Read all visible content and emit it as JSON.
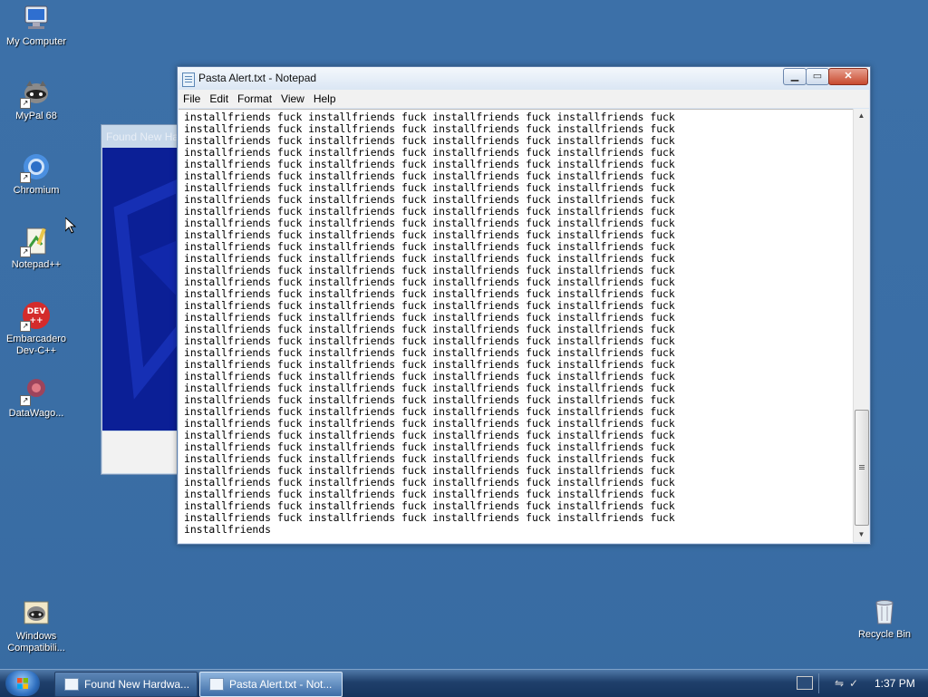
{
  "desktop": {
    "icons": [
      {
        "label": "My Computer",
        "icon": "computer-icon"
      },
      {
        "label": "MyPal 68",
        "icon": "raccoon-browser-icon"
      },
      {
        "label": "Chromium",
        "icon": "chromium-icon"
      },
      {
        "label": "Notepad++",
        "icon": "notepadpp-icon"
      },
      {
        "label": "Embarcadero Dev-C++",
        "icon": "devcpp-icon"
      },
      {
        "label": "DataWago...",
        "icon": "datawagon-icon"
      },
      {
        "label": "Windows Compatibili...",
        "icon": "raccoon-compat-icon"
      },
      {
        "label": "Recycle Bin",
        "icon": "recycle-bin-icon"
      }
    ]
  },
  "background_window": {
    "title": "Found New Ha..."
  },
  "notepad": {
    "title": "Pasta Alert.txt - Notepad",
    "menu": [
      "File",
      "Edit",
      "Format",
      "View",
      "Help"
    ],
    "text_line": "installfriends fuck installfriends fuck installfriends fuck installfriends fuck",
    "text_line_count": 35,
    "last_line": "installfriends"
  },
  "taskbar": {
    "buttons": [
      {
        "label": "Found New Hardwa..."
      },
      {
        "label": "Pasta Alert.txt - Not..."
      }
    ],
    "clock": "1:37 PM"
  },
  "colors": {
    "desktop": "#3a6ea5",
    "taskbar": "#16345d",
    "title_close": "#c74a2f"
  }
}
